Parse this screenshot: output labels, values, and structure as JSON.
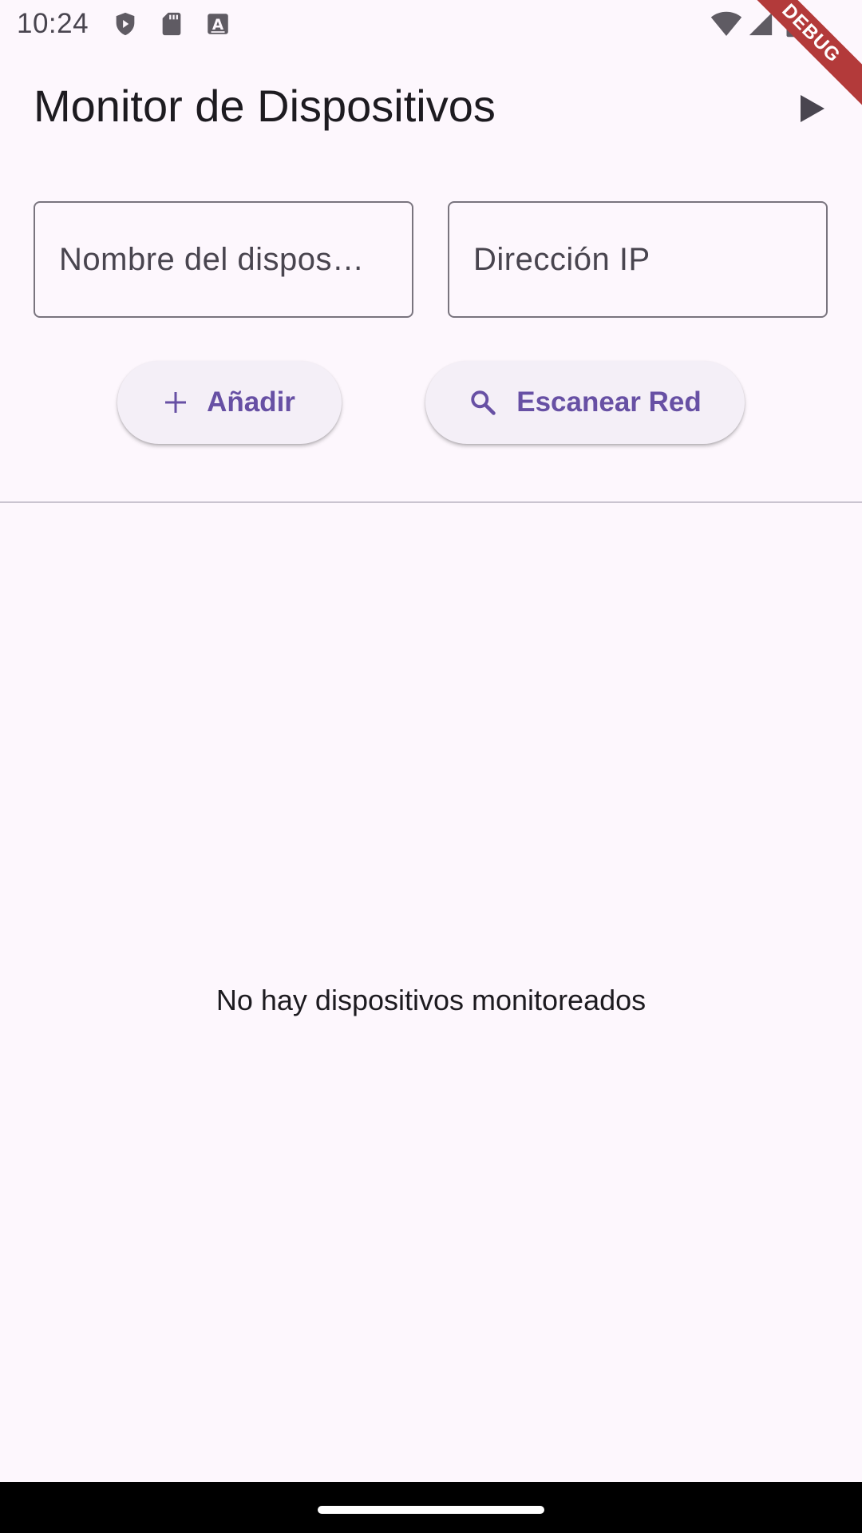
{
  "status_bar": {
    "time": "10:24",
    "icons": [
      "shield-play-icon",
      "sd-card-icon",
      "keyboard-a-icon",
      "wifi-icon",
      "cellular-signal-icon",
      "battery-icon"
    ]
  },
  "debug_banner": "DEBUG",
  "app_bar": {
    "title": "Monitor de Dispositivos",
    "action_icon": "play-icon"
  },
  "form": {
    "device_name_placeholder": "Nombre del dispos…",
    "ip_address_placeholder": "Dirección IP",
    "add_button_label": "Añadir",
    "scan_button_label": "Escanear Red"
  },
  "empty_state": {
    "message": "No hay dispositivos monitoreados"
  },
  "colors": {
    "background": "#fdf7fd",
    "primary": "#6750a4",
    "button_surface": "#f4eff7",
    "outline": "#79747e",
    "debug_ribbon": "#b33a3a"
  }
}
